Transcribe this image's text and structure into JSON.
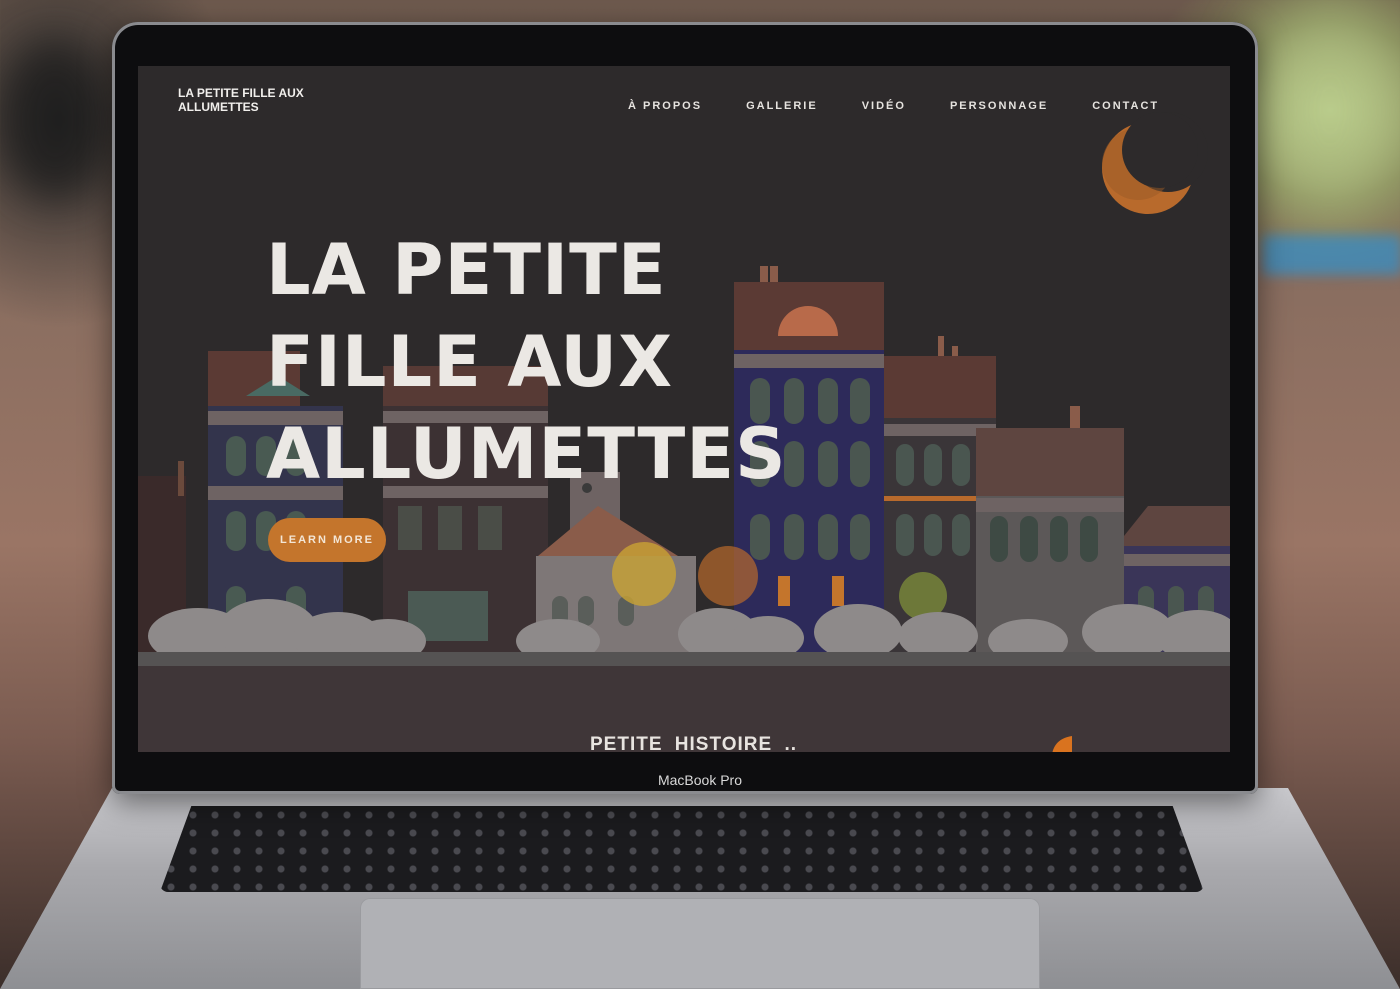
{
  "device": {
    "label": "MacBook Pro"
  },
  "site": {
    "title": "LA PETITE FILLE AUX ALLUMETTES",
    "nav": [
      {
        "label": "À PROPOS"
      },
      {
        "label": "GALLERIE"
      },
      {
        "label": "VIDÉO"
      },
      {
        "label": "PERSONNAGE"
      },
      {
        "label": "CONTACT"
      }
    ],
    "hero": {
      "lines": [
        "LA PETITE",
        "FILLE AUX",
        "ALLUMETTES"
      ],
      "cta_label": "LEARN MORE"
    },
    "section_heading": "PETITE  HISTOIRE .."
  },
  "colors": {
    "screen_bg": "#2d2a2b",
    "accent_orange": "#c4752c",
    "moon": "#b86a2c",
    "text_light": "#ebe8e4"
  },
  "icons": {
    "moon": "crescent-moon-icon"
  }
}
